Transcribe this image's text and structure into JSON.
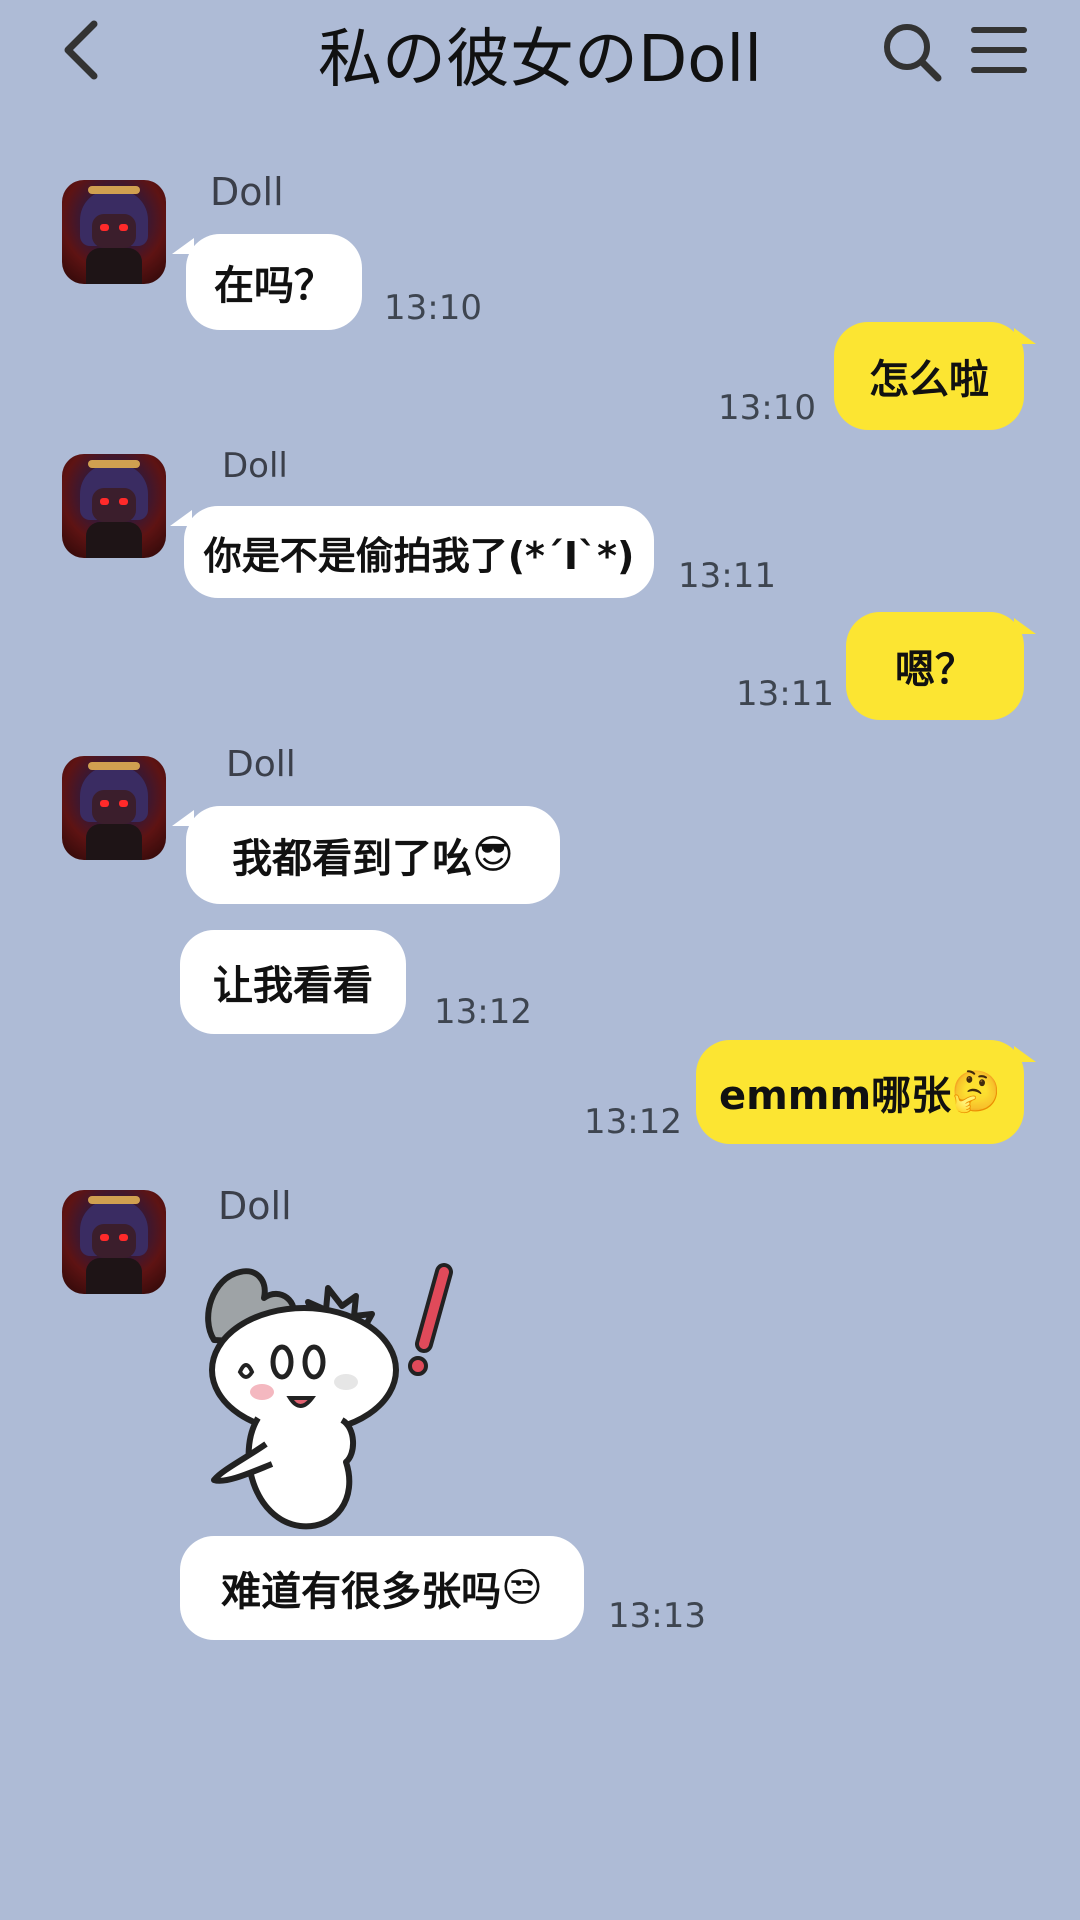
{
  "header": {
    "title": "私の彼女のDoll",
    "back_icon": "chevron-left-icon",
    "search_icon": "search-icon",
    "menu_icon": "hamburger-menu-icon"
  },
  "colors": {
    "background": "#aebbd6",
    "incoming_bubble": "#ffffff",
    "outgoing_bubble": "#fce532"
  },
  "messages": [
    {
      "side": "in",
      "sender": "Doll",
      "text": "在吗？",
      "time": "13:10"
    },
    {
      "side": "out",
      "text": "怎么啦",
      "time": "13:10"
    },
    {
      "side": "in",
      "sender": "Doll",
      "text": "你是不是偷拍我了(*´I`*)",
      "time": "13:11"
    },
    {
      "side": "out",
      "text": "嗯？",
      "time": "13:11"
    },
    {
      "side": "in",
      "sender": "Doll",
      "text": "我都看到了吆",
      "emoji": "😎"
    },
    {
      "side": "in",
      "text": "让我看看",
      "time": "13:12"
    },
    {
      "side": "out",
      "text": "emmm哪张",
      "emoji": "🤔",
      "time": "13:12"
    },
    {
      "side": "in",
      "sender": "Doll",
      "sticker": "surprised-bunny-sticker"
    },
    {
      "side": "in",
      "text": "难道有很多张吗",
      "emoji": "😒",
      "time": "13:13"
    }
  ]
}
